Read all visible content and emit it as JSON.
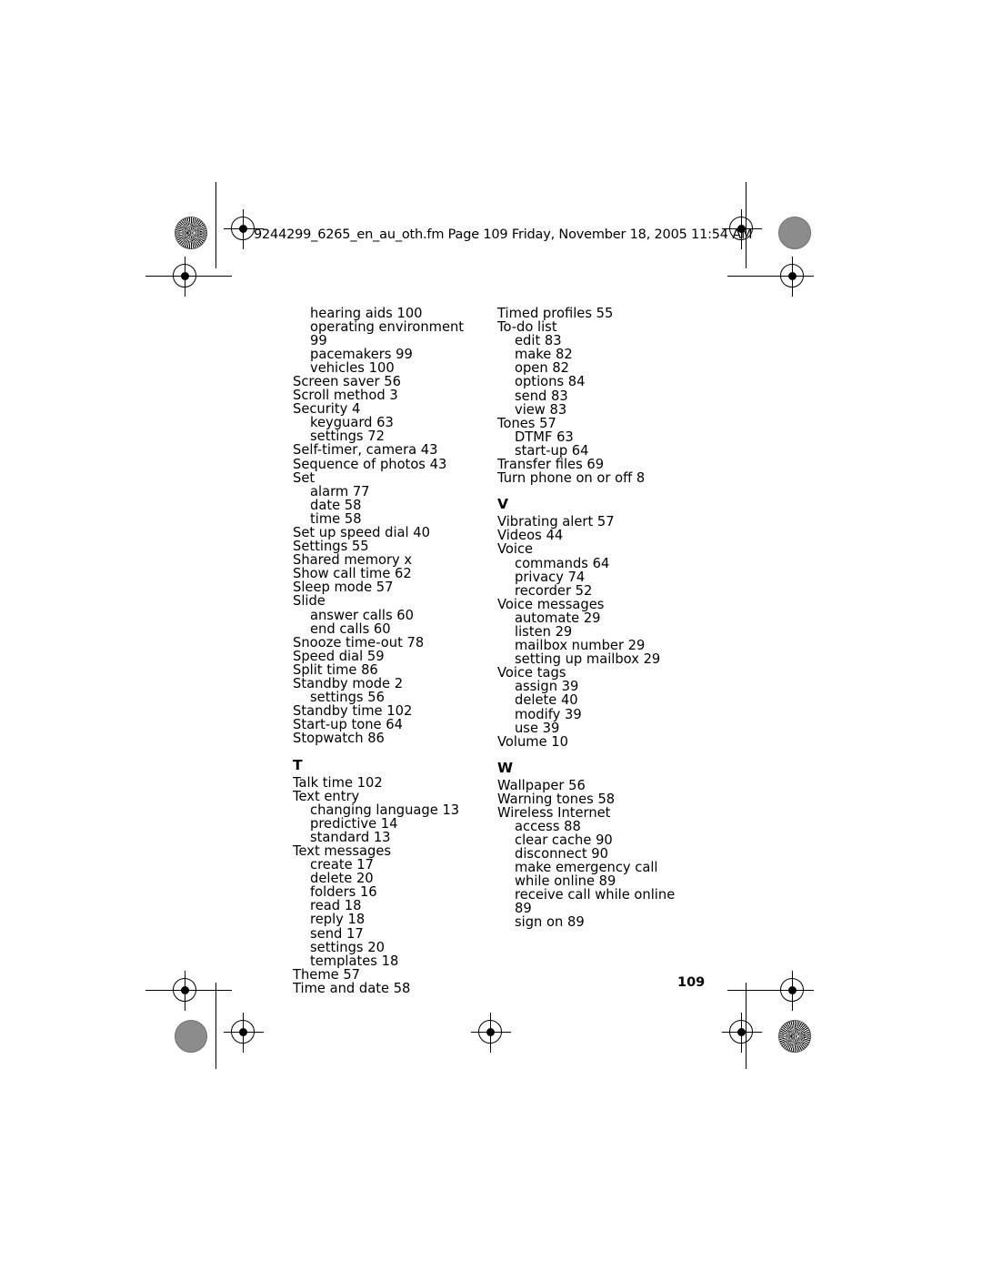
{
  "header": {
    "text": "9244299_6265_en_au_oth.fm  Page 109  Friday, November 18, 2005  11:54 AM"
  },
  "page_number": "109",
  "columns": [
    {
      "name": "left-column",
      "blocks": [
        {
          "letter": "",
          "entries": [
            {
              "text": "hearing aids 100",
              "level": 1
            },
            {
              "text": "operating environment 99",
              "level": 1
            },
            {
              "text": "pacemakers 99",
              "level": 1
            },
            {
              "text": "vehicles 100",
              "level": 1
            },
            {
              "text": "Screen saver 56",
              "level": 0
            },
            {
              "text": "Scroll method 3",
              "level": 0
            },
            {
              "text": "Security 4",
              "level": 0
            },
            {
              "text": "keyguard 63",
              "level": 1
            },
            {
              "text": "settings 72",
              "level": 1
            },
            {
              "text": "Self-timer, camera 43",
              "level": 0
            },
            {
              "text": "Sequence of photos 43",
              "level": 0
            },
            {
              "text": "Set",
              "level": 0
            },
            {
              "text": "alarm 77",
              "level": 1
            },
            {
              "text": "date 58",
              "level": 1
            },
            {
              "text": "time 58",
              "level": 1
            },
            {
              "text": "Set up speed dial 40",
              "level": 0
            },
            {
              "text": "Settings 55",
              "level": 0
            },
            {
              "text": "Shared memory x",
              "level": 0
            },
            {
              "text": "Show call time 62",
              "level": 0
            },
            {
              "text": "Sleep mode 57",
              "level": 0
            },
            {
              "text": "Slide",
              "level": 0
            },
            {
              "text": "answer calls 60",
              "level": 1
            },
            {
              "text": "end calls 60",
              "level": 1
            },
            {
              "text": "Snooze time-out 78",
              "level": 0
            },
            {
              "text": "Speed dial 59",
              "level": 0
            },
            {
              "text": "Split time 86",
              "level": 0
            },
            {
              "text": "Standby mode 2",
              "level": 0
            },
            {
              "text": "settings 56",
              "level": 1
            },
            {
              "text": "Standby time 102",
              "level": 0
            },
            {
              "text": "Start-up tone 64",
              "level": 0
            },
            {
              "text": "Stopwatch 86",
              "level": 0
            }
          ]
        },
        {
          "letter": "T",
          "entries": [
            {
              "text": "Talk time 102",
              "level": 0
            },
            {
              "text": "Text entry",
              "level": 0
            },
            {
              "text": "changing language 13",
              "level": 1
            },
            {
              "text": "predictive 14",
              "level": 1
            },
            {
              "text": "standard 13",
              "level": 1
            },
            {
              "text": "Text messages",
              "level": 0
            },
            {
              "text": "create 17",
              "level": 1
            },
            {
              "text": "delete 20",
              "level": 1
            },
            {
              "text": "folders 16",
              "level": 1
            },
            {
              "text": "read 18",
              "level": 1
            },
            {
              "text": "reply 18",
              "level": 1
            },
            {
              "text": "send 17",
              "level": 1
            },
            {
              "text": "settings 20",
              "level": 1
            },
            {
              "text": "templates 18",
              "level": 1
            },
            {
              "text": "Theme 57",
              "level": 0
            },
            {
              "text": "Time and date 58",
              "level": 0
            }
          ]
        }
      ]
    },
    {
      "name": "right-column",
      "blocks": [
        {
          "letter": "",
          "entries": [
            {
              "text": "Timed profiles 55",
              "level": 0
            },
            {
              "text": "To-do list",
              "level": 0
            },
            {
              "text": "edit 83",
              "level": 1
            },
            {
              "text": "make 82",
              "level": 1
            },
            {
              "text": "open 82",
              "level": 1
            },
            {
              "text": "options 84",
              "level": 1
            },
            {
              "text": "send 83",
              "level": 1
            },
            {
              "text": "view 83",
              "level": 1
            },
            {
              "text": "Tones 57",
              "level": 0
            },
            {
              "text": "DTMF 63",
              "level": 1
            },
            {
              "text": "start-up 64",
              "level": 1
            },
            {
              "text": "Transfer files 69",
              "level": 0
            },
            {
              "text": "Turn phone on or off 8",
              "level": 0
            }
          ]
        },
        {
          "letter": "V",
          "entries": [
            {
              "text": "Vibrating alert 57",
              "level": 0
            },
            {
              "text": "Videos 44",
              "level": 0
            },
            {
              "text": "Voice",
              "level": 0
            },
            {
              "text": "commands 64",
              "level": 1
            },
            {
              "text": "privacy 74",
              "level": 1
            },
            {
              "text": "recorder 52",
              "level": 1
            },
            {
              "text": "Voice messages",
              "level": 0
            },
            {
              "text": "automate 29",
              "level": 1
            },
            {
              "text": "listen 29",
              "level": 1
            },
            {
              "text": "mailbox number 29",
              "level": 1
            },
            {
              "text": "setting up mailbox 29",
              "level": 1
            },
            {
              "text": "Voice tags",
              "level": 0
            },
            {
              "text": "assign 39",
              "level": 1
            },
            {
              "text": "delete 40",
              "level": 1
            },
            {
              "text": "modify 39",
              "level": 1
            },
            {
              "text": "use 39",
              "level": 1
            },
            {
              "text": "Volume 10",
              "level": 0
            }
          ]
        },
        {
          "letter": "W",
          "entries": [
            {
              "text": "Wallpaper 56",
              "level": 0
            },
            {
              "text": "Warning tones 58",
              "level": 0
            },
            {
              "text": "Wireless Internet",
              "level": 0
            },
            {
              "text": "access 88",
              "level": 1
            },
            {
              "text": "clear cache 90",
              "level": 1
            },
            {
              "text": "disconnect 90",
              "level": 1
            },
            {
              "text": "make emergency call while online 89",
              "level": 1
            },
            {
              "text": "receive call while online 89",
              "level": 1
            },
            {
              "text": "sign on 89",
              "level": 1
            }
          ]
        }
      ]
    }
  ]
}
